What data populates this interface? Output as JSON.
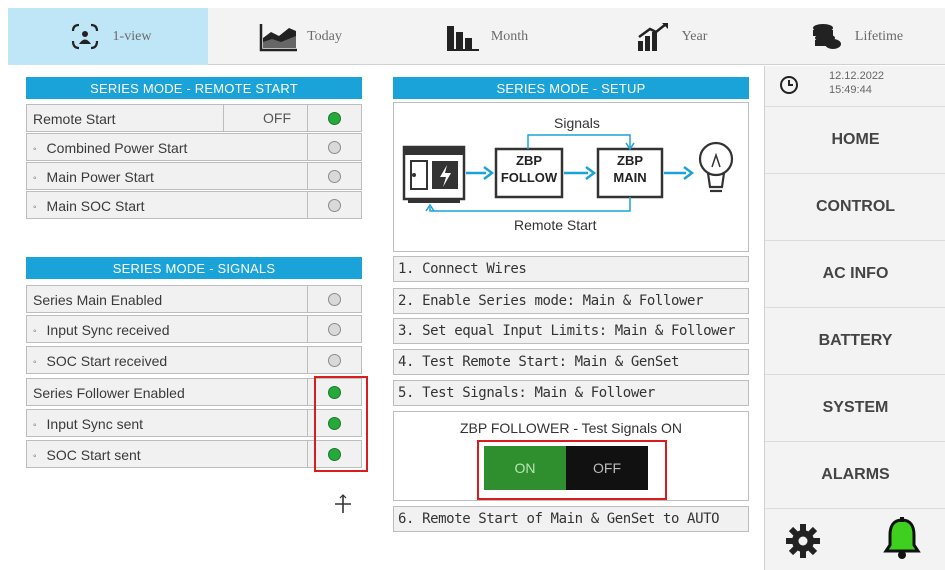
{
  "tabs": [
    {
      "label": "1-view",
      "icon": "dashboard-icon"
    },
    {
      "label": "Today",
      "icon": "area-chart-icon"
    },
    {
      "label": "Month",
      "icon": "bar-chart-icon"
    },
    {
      "label": "Year",
      "icon": "trend-chart-icon"
    },
    {
      "label": "Lifetime",
      "icon": "stack-icon"
    }
  ],
  "remote_panel": {
    "title": "SERIES MODE - REMOTE START",
    "rows": [
      {
        "label": "Remote Start",
        "value": "OFF",
        "status": "on"
      },
      {
        "label": "Combined Power Start",
        "status": "off"
      },
      {
        "label": "Main Power Start",
        "status": "off"
      },
      {
        "label": "Main SOC Start",
        "status": "off"
      }
    ]
  },
  "signals_panel": {
    "title": "SERIES MODE - SIGNALS",
    "rows": [
      {
        "label": "Series Main Enabled",
        "status": "off"
      },
      {
        "label": "Input Sync received",
        "status": "off"
      },
      {
        "label": "SOC Start received",
        "status": "off"
      },
      {
        "label": "Series Follower Enabled",
        "status": "on"
      },
      {
        "label": "Input Sync sent",
        "status": "on"
      },
      {
        "label": "SOC Start sent",
        "status": "on"
      }
    ]
  },
  "setup_panel": {
    "title": "SERIES MODE - SETUP",
    "diagram": {
      "signals_label": "Signals",
      "follow_line1": "ZBP",
      "follow_line2": "FOLLOW",
      "main_line1": "ZBP",
      "main_line2": "MAIN",
      "remote_label": "Remote Start"
    },
    "steps": [
      "1. Connect Wires",
      "2. Enable Series mode: Main & Follower",
      "3. Set equal Input Limits: Main & Follower",
      "4. Test Remote Start: Main & GenSet",
      "5. Test Signals: Main & Follower"
    ],
    "test_signals_label": "ZBP FOLLOWER - Test Signals ON",
    "toggle_on": "ON",
    "toggle_off": "OFF",
    "step6": "6. Remote Start of Main & GenSet to AUTO"
  },
  "clock": {
    "date": "12.12.2022",
    "time": "15:49:44"
  },
  "nav": [
    "HOME",
    "CONTROL",
    "AC INFO",
    "BATTERY",
    "SYSTEM",
    "ALARMS"
  ],
  "colors": {
    "header_blue": "#1aa3d8",
    "active_tab": "#bfe6f6",
    "led_on": "#27a83a",
    "led_off": "#d9d9d9",
    "toggle_on": "#2f8f2f",
    "toggle_off": "#111111",
    "highlight_red": "#d91c1c",
    "bell_green": "#3fcf1e"
  }
}
